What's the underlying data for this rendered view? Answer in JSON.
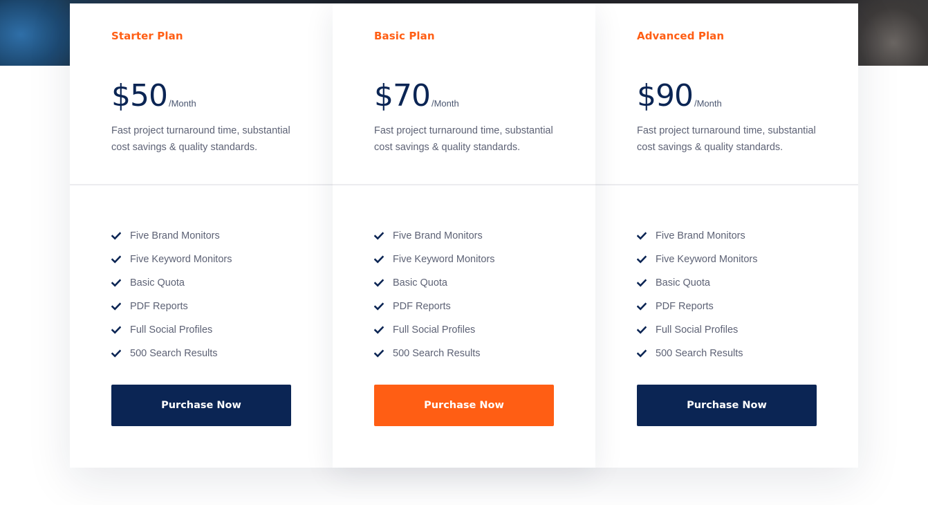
{
  "colors": {
    "accent": "#ff5e14",
    "navy": "#0b2554",
    "text": "#5d6275"
  },
  "plans": [
    {
      "name": "Starter Plan",
      "price": "$50",
      "period": "/Month",
      "description": "Fast project turnaround time, substantial cost savings & quality standards.",
      "features": [
        "Five Brand Monitors",
        "Five Keyword Monitors",
        "Basic Quota",
        "PDF Reports",
        "Full Social Profiles",
        "500 Search Results"
      ],
      "button_label": "Purchase Now",
      "button_color": "#0b2554"
    },
    {
      "name": "Basic Plan",
      "price": "$70",
      "period": "/Month",
      "description": "Fast project turnaround time, substantial cost savings & quality standards.",
      "features": [
        "Five Brand Monitors",
        "Five Keyword Monitors",
        "Basic Quota",
        "PDF Reports",
        "Full Social Profiles",
        "500 Search Results"
      ],
      "button_label": "Purchase Now",
      "button_color": "#ff5e14"
    },
    {
      "name": "Advanced Plan",
      "price": "$90",
      "period": "/Month",
      "description": "Fast project turnaround time, substantial cost savings & quality standards.",
      "features": [
        "Five Brand Monitors",
        "Five Keyword Monitors",
        "Basic Quota",
        "PDF Reports",
        "Full Social Profiles",
        "500 Search Results"
      ],
      "button_label": "Purchase Now",
      "button_color": "#0b2554"
    }
  ],
  "feature_icon": "check-icon"
}
